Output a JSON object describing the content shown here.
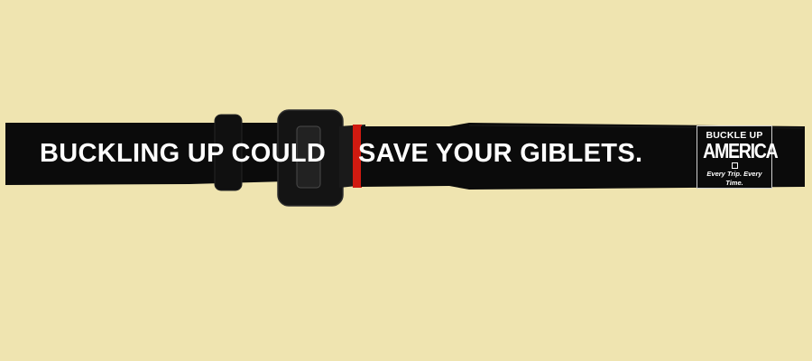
{
  "ad": {
    "slogan_left": "BUCKLING UP COULD",
    "slogan_right": "SAVE YOUR GIBLETS.",
    "logo": {
      "line1": "BUCKLE UP",
      "line2": "AMERICA",
      "tagline": "Every Trip. Every Time."
    }
  },
  "colors": {
    "background": "#efe4b0",
    "belt": "#0a0a0a",
    "latch_red": "#d01a10",
    "text": "#ffffff"
  }
}
